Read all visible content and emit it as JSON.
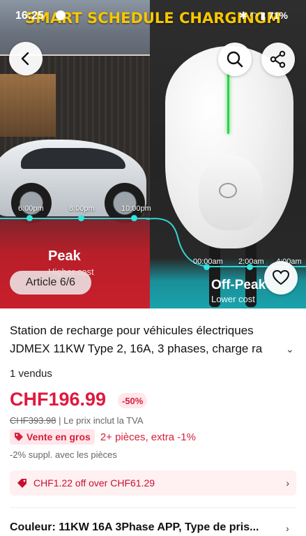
{
  "status_bar": {
    "time": "16:25",
    "icons": "✱ ◠ ▮ 71%"
  },
  "hero": {
    "overlay_title": "SMART SCHEDULE CHARGINGM",
    "peak_times": [
      "6:00pm",
      "8:00pm",
      "10:00pm"
    ],
    "offpeak_times": [
      "00:00am",
      "2:00am",
      "4:00am"
    ],
    "peak_label": "Peak",
    "peak_sub": "Higher cost",
    "offpeak_label": "Off-Peak",
    "offpeak_sub": "Lower cost",
    "article_counter": "Article 6/6",
    "colors": {
      "peak": "#c81f2c",
      "offpeak": "#1aa3ad",
      "title": "#f7c700",
      "led": "#2fd14a"
    }
  },
  "nav": {
    "back_icon": "chevron-left-icon",
    "search_icon": "search-icon",
    "share_icon": "share-icon",
    "favorite_icon": "heart-icon"
  },
  "product": {
    "title_line1": "Station de recharge pour véhicules électriques",
    "title_line2": "JDMEX 11KW Type 2, 16A, 3 phases, charge ra",
    "sold": "1 vendus",
    "price": "CHF196.99",
    "discount": "-50%",
    "old_price": "CHF393.98",
    "vat_note": " | Le prix inclut la TVA",
    "bulk_badge": "Vente en gros",
    "bulk_offer": "2+ pièces, extra -1%",
    "pieces_note": "-2% suppl. avec les pièces",
    "coupon": "CHF1.22 off over CHF61.29",
    "color_option": "Couleur: 11KW 16A 3Phase APP, Type de pris..."
  },
  "accent_color": "#e0183d"
}
